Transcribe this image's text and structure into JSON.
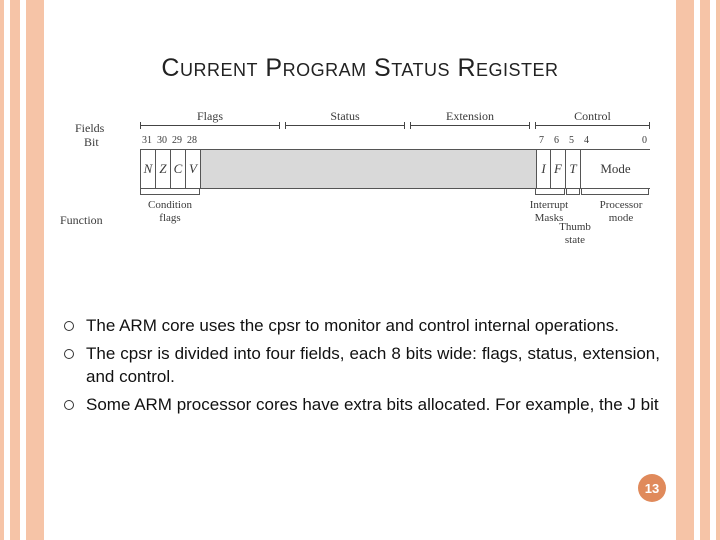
{
  "title": "Current Program Status Register",
  "diagram": {
    "row_labels": {
      "fields": "Fields",
      "bit": "Bit",
      "function": "Function"
    },
    "field_ranges": [
      "Flags",
      "Status",
      "Extension",
      "Control"
    ],
    "bit_numbers_left": [
      "31",
      "30",
      "29",
      "28"
    ],
    "bit_numbers_right": [
      "7",
      "6",
      "5",
      "4",
      "0"
    ],
    "flag_cells": [
      "N",
      "Z",
      "C",
      "V"
    ],
    "ctrl_cells": [
      "I",
      "F",
      "T"
    ],
    "mode_cell": "Mode",
    "func_labels": {
      "condition": "Condition\nflags",
      "interrupt": "Interrupt\nMasks",
      "thumb": "Thumb\nstate",
      "processor": "Processor\nmode"
    }
  },
  "bullets": [
    "The ARM core uses the cpsr to monitor and control internal operations.",
    "The cpsr is divided into four fields, each 8 bits wide: flags, status, extension, and control.",
    "Some ARM processor cores have extra bits allocated. For example, the J bit"
  ],
  "page_number": "13"
}
